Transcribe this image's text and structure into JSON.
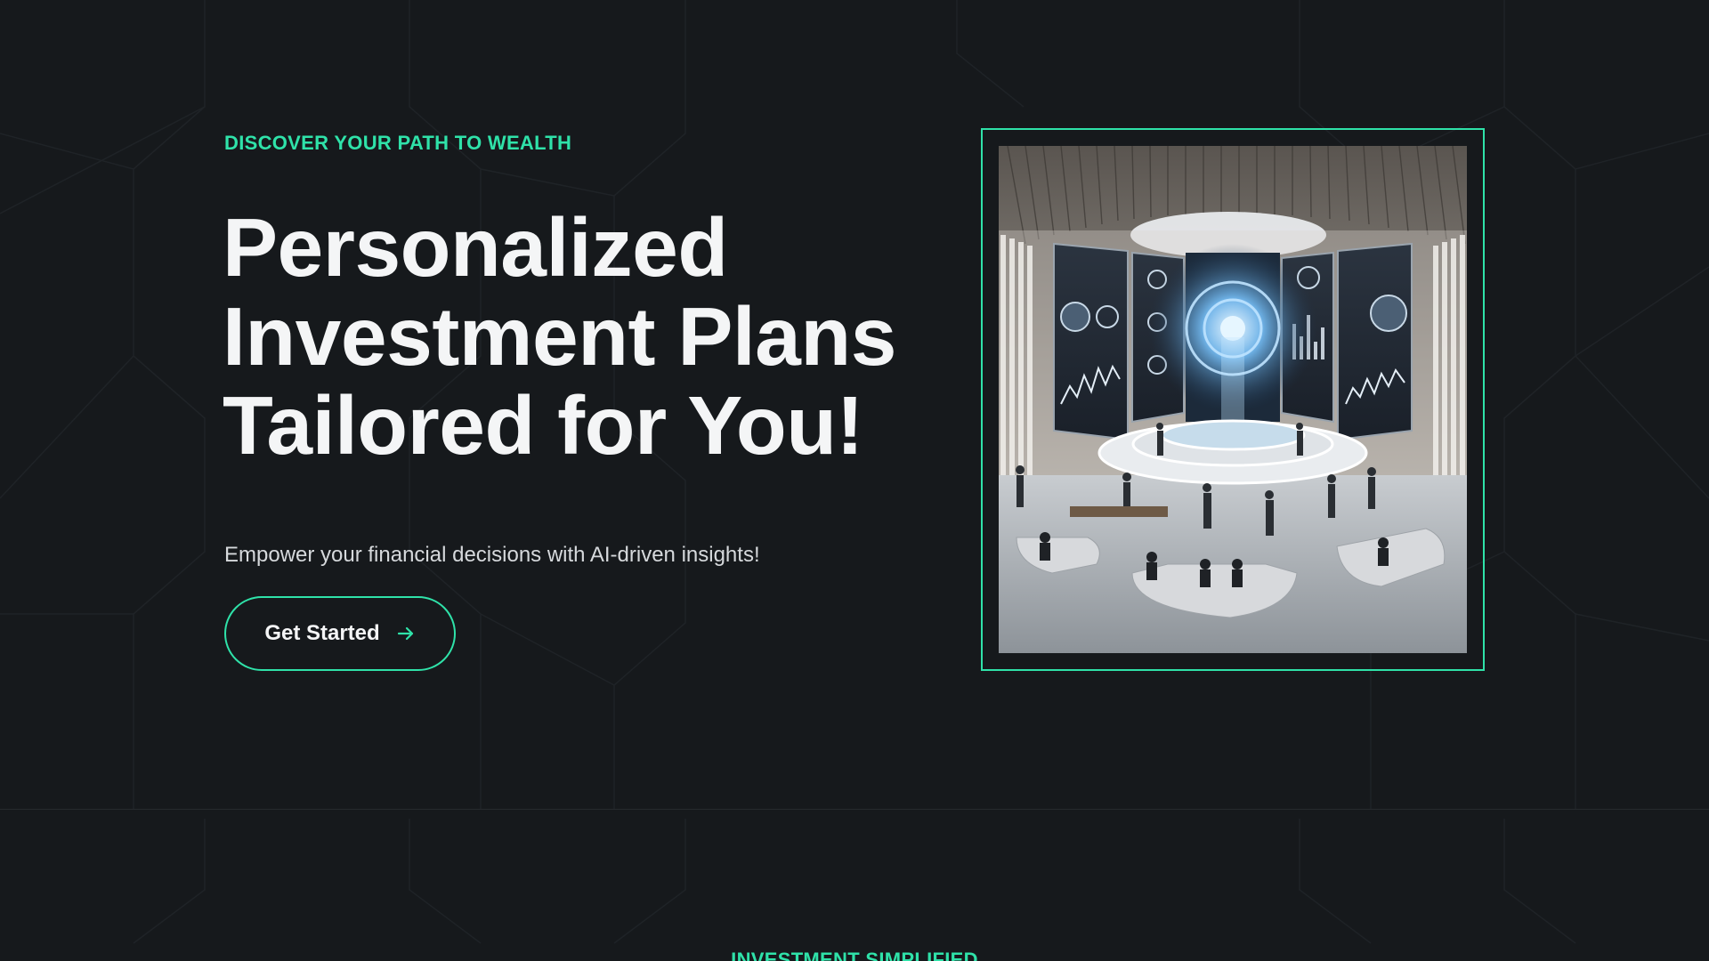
{
  "hero": {
    "eyebrow": "DISCOVER YOUR PATH TO WEALTH",
    "headline_lines": [
      "Personalized",
      "Investment Plans",
      "Tailored for You!"
    ],
    "subtitle": "Empower your financial decisions with AI-driven insights!",
    "cta_label": "Get Started",
    "cta_icon": "arrow-right-icon",
    "image_alt": "AI investment command center with holographic dashboards"
  },
  "next_section": {
    "eyebrow": "INVESTMENT SIMPLIFIED"
  },
  "colors": {
    "background": "#16191c",
    "accent": "#2fe2a9",
    "heading": "#f4f5f6",
    "body_text": "#d6d9dc"
  }
}
